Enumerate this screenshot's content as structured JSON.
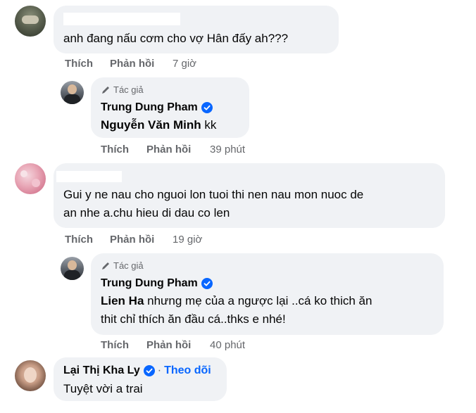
{
  "comments": [
    {
      "text": "anh đang nấu cơm cho vợ Hân đấy ah???",
      "like": "Thích",
      "reply": "Phản hồi",
      "time": "7 giờ"
    },
    {
      "author_badge": "Tác giả",
      "name": "Trung Dung Pham",
      "mention": "Nguyễn Văn Minh",
      "text": " kk",
      "like": "Thích",
      "reply": "Phản hồi",
      "time": "39 phút"
    },
    {
      "line1": "Gui y ne nau cho nguoi lon tuoi thi nen nau mon nuoc de",
      "line2": "an nhe a.chu hieu di dau co len",
      "like": "Thích",
      "reply": "Phản hồi",
      "time": "19 giờ"
    },
    {
      "author_badge": "Tác giả",
      "name": "Trung Dung Pham",
      "mention": "Lien Ha",
      "line1": " nhưng mẹ của a ngược lại ..cá ko thich ăn",
      "line2": "thit chỉ thích ăn đầu cá..thks e nhé!",
      "like": "Thích",
      "reply": "Phản hồi",
      "time": "40 phút"
    },
    {
      "name": "Lại Thị Kha Ly",
      "separator": "·",
      "follow": "Theo dõi",
      "text": "Tuyệt vời a trai"
    }
  ],
  "colors": {
    "bubble": "#f0f2f5",
    "secondary_text": "#65676b",
    "verified": "#0866ff",
    "follow_link": "#0866ff"
  },
  "icons": [
    "pen-icon",
    "verified-badge-icon"
  ]
}
